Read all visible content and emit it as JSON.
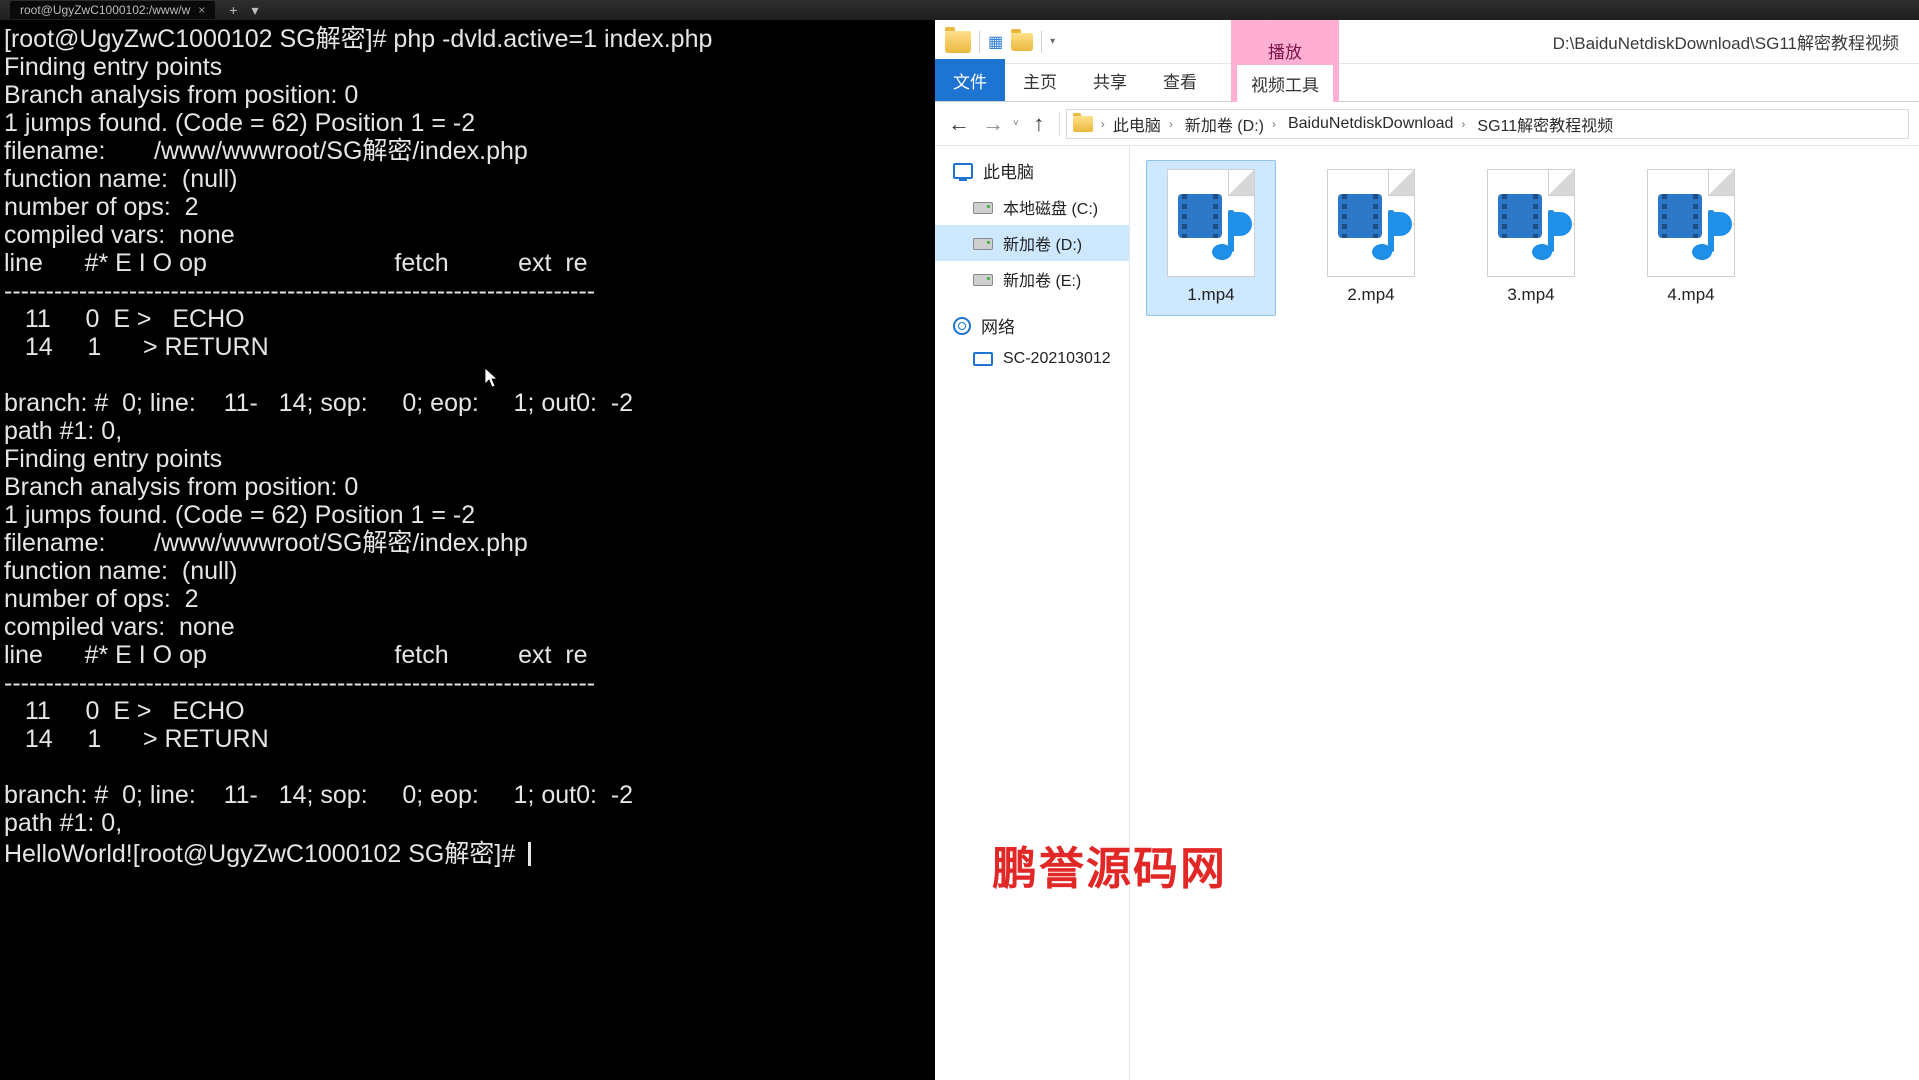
{
  "tabbar": {
    "tab_label": "root@UgyZwC1000102:/www/w",
    "close_glyph": "×",
    "plus_glyph": "+",
    "dd_glyph": "▾"
  },
  "terminal": {
    "lines": [
      "[root@UgyZwC1000102 SG解密]# php -dvld.active=1 index.php",
      "Finding entry points",
      "Branch analysis from position: 0",
      "1 jumps found. (Code = 62) Position 1 = -2",
      "filename:       /www/wwwroot/SG解密/index.php",
      "function name:  (null)",
      "number of ops:  2",
      "compiled vars:  none",
      "line      #* E I O op                           fetch          ext  re",
      "-----------------------------------------------------------------------",
      "   11     0  E >   ECHO",
      "   14     1      > RETURN",
      "",
      "branch: #  0; line:    11-   14; sop:     0; eop:     1; out0:  -2",
      "path #1: 0,",
      "Finding entry points",
      "Branch analysis from position: 0",
      "1 jumps found. (Code = 62) Position 1 = -2",
      "filename:       /www/wwwroot/SG解密/index.php",
      "function name:  (null)",
      "number of ops:  2",
      "compiled vars:  none",
      "line      #* E I O op                           fetch          ext  re",
      "-----------------------------------------------------------------------",
      "   11     0  E >   ECHO",
      "   14     1      > RETURN",
      "",
      "branch: #  0; line:    11-   14; sop:     0; eop:     1; out0:  -2",
      "path #1: 0,",
      "HelloWorld![root@UgyZwC1000102 SG解密]# "
    ]
  },
  "explorer": {
    "title_path": "D:\\BaiduNetdiskDownload\\SG11解密教程视频",
    "context_tab": "播放",
    "context_sub": "视频工具",
    "tabs": {
      "file": "文件",
      "home": "主页",
      "share": "共享",
      "view": "查看"
    },
    "nav": {
      "back_glyph": "←",
      "fwd_glyph": "→",
      "up_glyph": "↑",
      "dd_glyph": "˅"
    },
    "crumbs": [
      "此电脑",
      "新加卷 (D:)",
      "BaiduNetdiskDownload",
      "SG11解密教程视频"
    ],
    "sidebar": {
      "pc": "此电脑",
      "drive_c": "本地磁盘 (C:)",
      "drive_d": "新加卷 (D:)",
      "drive_e": "新加卷 (E:)",
      "network": "网络",
      "host": "SC-202103012"
    },
    "files": [
      {
        "name": "1.mp4",
        "selected": true
      },
      {
        "name": "2.mp4",
        "selected": false
      },
      {
        "name": "3.mp4",
        "selected": false
      },
      {
        "name": "4.mp4",
        "selected": false
      }
    ]
  },
  "watermark": "鹏誉源码网"
}
